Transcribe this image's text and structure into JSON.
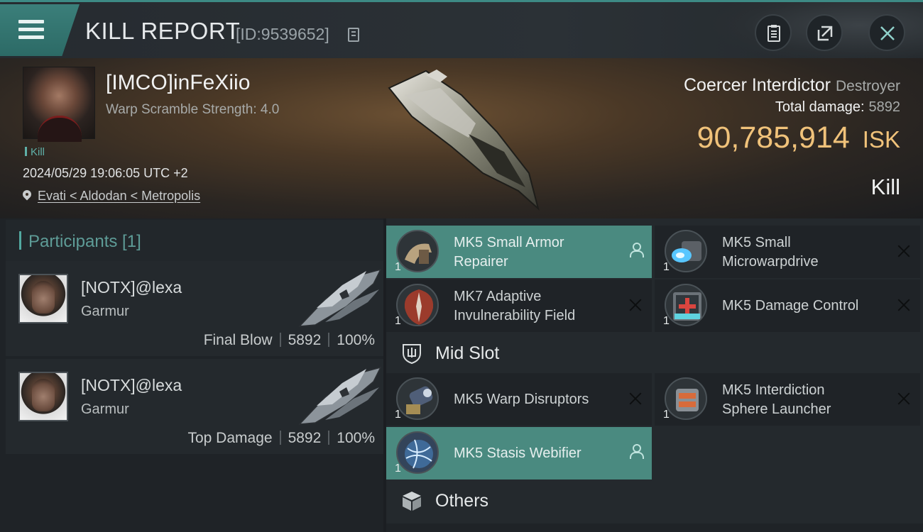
{
  "header": {
    "title": "KILL REPORT",
    "report_id": "[ID:9539652]",
    "icons": [
      "menu-icon",
      "copy-icon",
      "clipboard-icon",
      "share-icon",
      "close-icon"
    ]
  },
  "victim": {
    "name": "[IMCO]inFeXiio",
    "warp_scramble": "Warp Scramble Strength: 4.0",
    "tag": "Kill",
    "datetime": "2024/05/29 19:06:05 UTC +2",
    "location": "Evati < Aldodan < Metropolis",
    "ship_name": "Coercer Interdictor",
    "ship_class": "Destroyer",
    "total_damage_label": "Total damage:",
    "total_damage_value": "5892",
    "isk_value": "90,785,914",
    "isk_unit": "ISK",
    "result": "Kill"
  },
  "participants": {
    "label": "Participants [1]",
    "items": [
      {
        "name": "[NOTX]@lexa",
        "ship": "Garmur",
        "role": "Final Blow",
        "damage": "5892",
        "percent": "100%"
      },
      {
        "name": "[NOTX]@lexa",
        "ship": "Garmur",
        "role": "Top Damage",
        "damage": "5892",
        "percent": "100%"
      }
    ]
  },
  "modules": {
    "low_slot": [
      {
        "name_l1": "MK5 Small Armor",
        "name_l2": "Repairer",
        "qty": "1",
        "icon": "armor-repairer-icon",
        "state": "active"
      },
      {
        "name_l1": "MK5 Small",
        "name_l2": "Microwarpdrive",
        "qty": "1",
        "icon": "microwarpdrive-icon",
        "state": "destroyed"
      },
      {
        "name_l1": "MK7 Adaptive",
        "name_l2": "Invulnerability Field",
        "qty": "1",
        "icon": "invulnerability-field-icon",
        "state": "destroyed"
      },
      {
        "name_l1": "MK5 Damage Control",
        "name_l2": "",
        "qty": "1",
        "icon": "damage-control-icon",
        "state": "destroyed"
      }
    ],
    "mid_slot_label": "Mid Slot",
    "mid_slot": [
      {
        "name_l1": "MK5 Warp Disruptors",
        "name_l2": "",
        "qty": "1",
        "icon": "warp-disruptor-icon",
        "state": "destroyed"
      },
      {
        "name_l1": "MK5 Interdiction",
        "name_l2": "Sphere Launcher",
        "qty": "1",
        "icon": "interdiction-launcher-icon",
        "state": "destroyed"
      },
      {
        "name_l1": "MK5 Stasis Webifier",
        "name_l2": "",
        "qty": "1",
        "icon": "stasis-webifier-icon",
        "state": "active"
      }
    ],
    "others_label": "Others"
  },
  "colors": {
    "accent": "#4a8a80",
    "isk": "#f0c27a",
    "panel": "#1f2327"
  }
}
